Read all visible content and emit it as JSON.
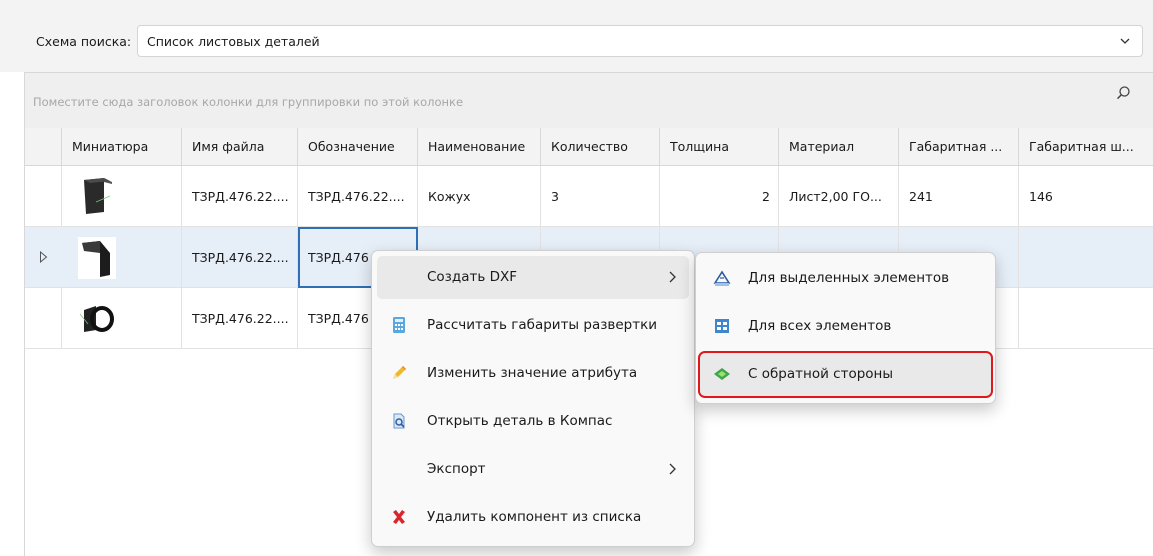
{
  "search_scheme": {
    "label": "Схема поиска:",
    "value": "Список листовых деталей",
    "chevron_icon": "chevron-down-icon"
  },
  "grid": {
    "group_hint": "Поместите сюда заголовок колонки для группировки по этой колонке",
    "search_icon": "search-icon",
    "columns": [
      "Миниатюра",
      "Имя файла",
      "Обозначение",
      "Наименование",
      "Количество",
      "Толщина",
      "Материал",
      "Габаритная ...",
      "Габаритная ш..."
    ],
    "rows": [
      {
        "file": "ТЗРД.476.22....",
        "designation": "ТЗРД.476.22....",
        "name": "Кожух",
        "qty": "3",
        "thickness": "2",
        "material": "Лист2,00 ГО...",
        "dim1": "241",
        "dim2": "146",
        "thumbnail_icon": "sheet-part-thumbnail",
        "selected": false
      },
      {
        "file": "ТЗРД.476.22....",
        "designation": "ТЗРД.476",
        "name": "",
        "qty": "",
        "thickness": "",
        "material": "",
        "dim1": "",
        "dim2": "",
        "thumbnail_icon": "sheet-part-thumbnail",
        "selected": true
      },
      {
        "file": "ТЗРД.476.22....",
        "designation": "ТЗРД.476",
        "name": "",
        "qty": "",
        "thickness": "",
        "material": "",
        "dim1": "",
        "dim2": "",
        "thumbnail_icon": "sheet-part-thumbnail",
        "selected": false
      }
    ]
  },
  "context_menu": {
    "items": [
      {
        "label": "Создать DXF",
        "icon": "",
        "has_submenu": true
      },
      {
        "label": "Рассчитать габариты развертки",
        "icon": "calculator-icon",
        "has_submenu": false
      },
      {
        "label": "Изменить значение атрибута",
        "icon": "pencil-icon",
        "has_submenu": false
      },
      {
        "label": "Открыть деталь в Компас",
        "icon": "open-document-icon",
        "has_submenu": false
      },
      {
        "label": "Экспорт",
        "icon": "",
        "has_submenu": true
      },
      {
        "label": "Удалить компонент из списка",
        "icon": "delete-x-icon",
        "has_submenu": false
      }
    ]
  },
  "submenu": {
    "items": [
      {
        "label": "Для выделенных элементов",
        "icon": "dxf-selected-icon"
      },
      {
        "label": "Для всех элементов",
        "icon": "dxf-all-icon"
      },
      {
        "label": "С обратной стороны",
        "icon": "flip-side-icon",
        "highlighted": true
      }
    ],
    "highlight_color": "#e0181b"
  },
  "colors": {
    "selection_row": "#e6eef8",
    "focus_border": "#2f6fb5"
  }
}
